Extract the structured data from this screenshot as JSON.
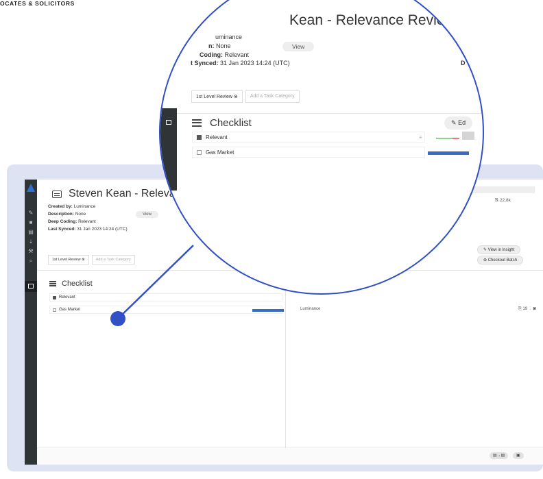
{
  "brand": {
    "text": "OCATES & SOLICITORS"
  },
  "sidebar": {
    "icons": [
      "logo-icon",
      "brush-icon",
      "document-icon",
      "book-icon",
      "download-icon",
      "wrench-icon",
      "search-icon",
      "database-icon"
    ]
  },
  "review": {
    "title": "Steven Kean - Relevance Review",
    "created_by_label": "Created by:",
    "created_by_value": "Luminance",
    "description_label": "Description:",
    "description_value": "None",
    "view_label": "View",
    "deep_coding_label": "Deep Coding:",
    "deep_coding_value": "Relevant",
    "last_synced_label": "Last Synced:",
    "last_synced_value": "31 Jan 2023 14:24 (UTC)"
  },
  "categories": {
    "chip": "1st Level Review",
    "add_placeholder": "Add a Task Category"
  },
  "checklist": {
    "heading": "Checklist",
    "edit_label": "Ed",
    "items": [
      {
        "label": "Relevant",
        "checked": true
      },
      {
        "label": "Gas Market",
        "checked": false
      }
    ]
  },
  "right_panel": {
    "doc_count": "22.8k",
    "view_in_insight": "View in Insight",
    "checkout_batch": "Checkout Batch",
    "assignee_name": "Luminance",
    "assignee_count": "19"
  },
  "lens": {
    "title_fragment": "Kean - Relevance Review",
    "created_by_value": "uminance",
    "description_fragment": "n:",
    "description_value": "None",
    "coding_label": "Coding:",
    "coding_value": "Relevant",
    "synced_label": "t Synced:",
    "synced_value": "31 Jan 2023 14:24 (UTC)",
    "de_fragment": "D"
  },
  "colors": {
    "accent": "#3150c6",
    "bar_blue": "#3a6cc6",
    "sidebar_bg": "#2f3437",
    "backdrop": "#dde3f3"
  }
}
